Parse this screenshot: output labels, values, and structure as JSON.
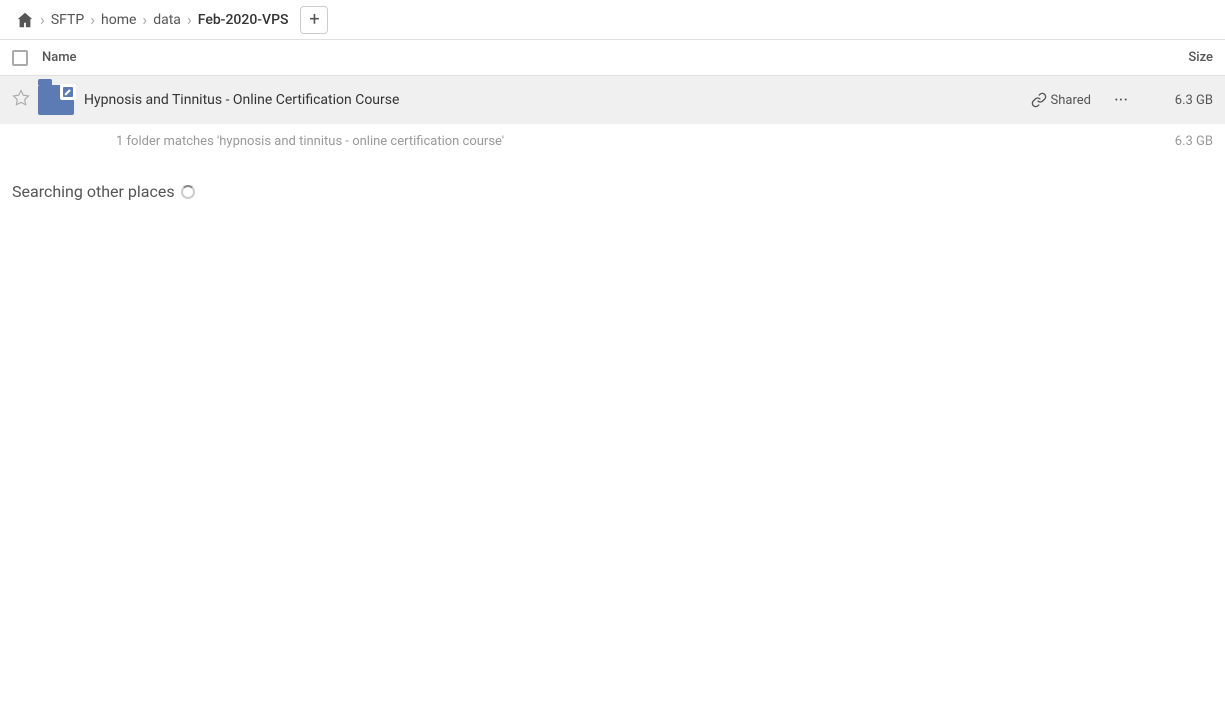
{
  "breadcrumb": {
    "home_label": "home",
    "items": [
      {
        "label": "SFTP",
        "active": false
      },
      {
        "label": "home",
        "active": false
      },
      {
        "label": "data",
        "active": false
      },
      {
        "label": "Feb-2020-VPS",
        "active": true
      }
    ],
    "add_button_label": "+"
  },
  "columns": {
    "name_label": "Name",
    "size_label": "Size"
  },
  "file_row": {
    "name": "Hypnosis and Tinnitus - Online Certification Course",
    "shared_label": "Shared",
    "size": "6.3 GB",
    "more_label": "···"
  },
  "match_info": {
    "text": "1 folder matches 'hypnosis and tinnitus - online certification course'",
    "size": "6.3 GB"
  },
  "searching": {
    "title": "Searching other places"
  }
}
